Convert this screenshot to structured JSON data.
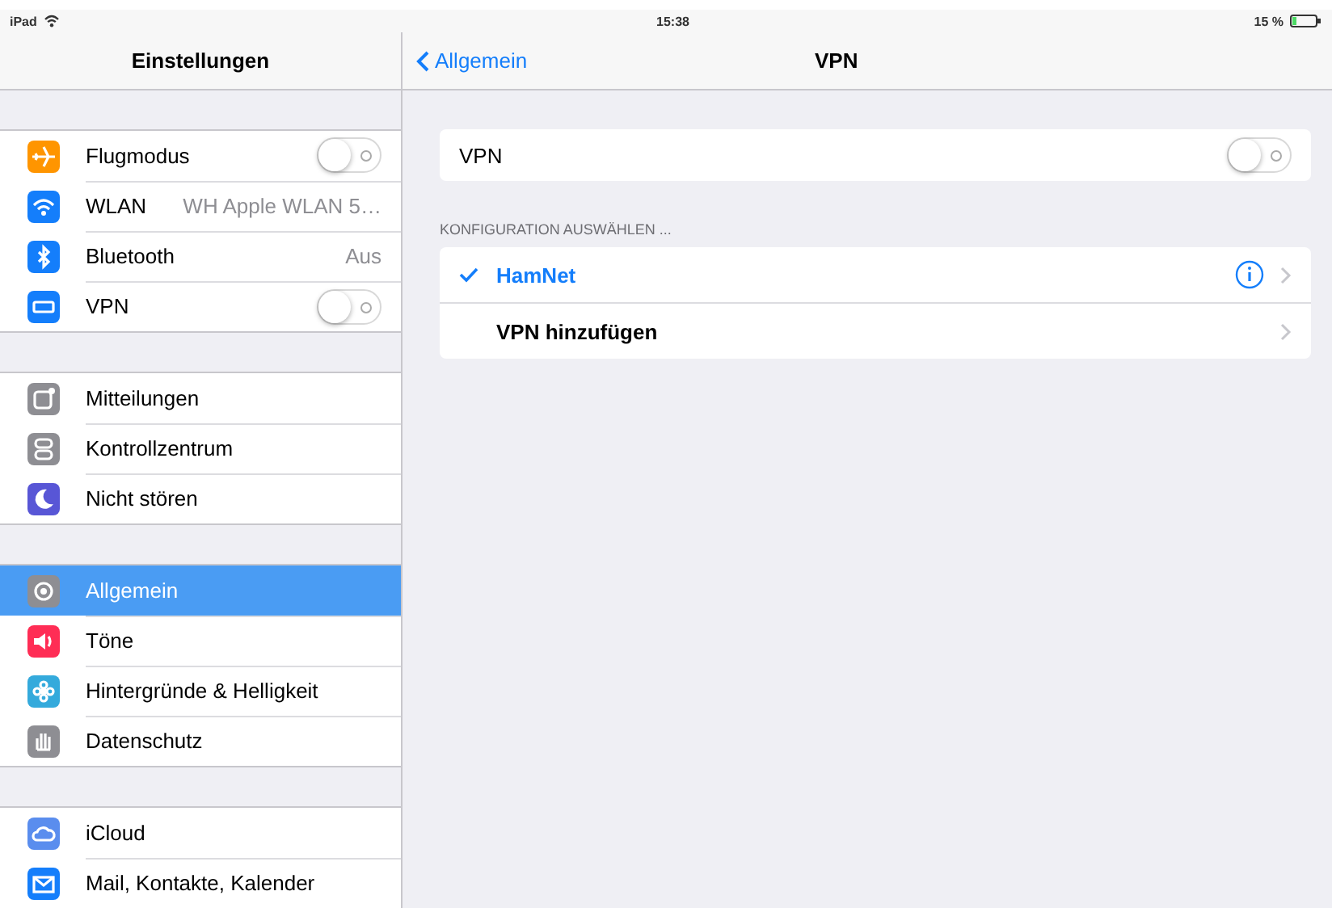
{
  "status_bar": {
    "device": "iPad",
    "time": "15:38",
    "battery": "15 %"
  },
  "sidebar": {
    "title": "Einstellungen",
    "groups": [
      {
        "items": [
          {
            "label": "Flugmodus",
            "kind": "toggle",
            "on": false,
            "selected": false,
            "color": "#ff9500"
          },
          {
            "label": "WLAN",
            "kind": "value",
            "value": "WH Apple WLAN 5…",
            "selected": false,
            "color": "#147efb"
          },
          {
            "label": "Bluetooth",
            "kind": "value",
            "value": "Aus",
            "selected": false,
            "color": "#147efb"
          },
          {
            "label": "VPN",
            "kind": "toggle",
            "on": false,
            "selected": false,
            "color": "#147efb"
          }
        ]
      },
      {
        "items": [
          {
            "label": "Mitteilungen",
            "kind": "plain",
            "selected": false,
            "color": "#8e8e93"
          },
          {
            "label": "Kontrollzentrum",
            "kind": "plain",
            "selected": false,
            "color": "#8e8e93"
          },
          {
            "label": "Nicht stören",
            "kind": "plain",
            "selected": false,
            "color": "#5856d6"
          }
        ]
      },
      {
        "items": [
          {
            "label": "Allgemein",
            "kind": "plain",
            "selected": true,
            "color": "#8e8e93"
          },
          {
            "label": "Töne",
            "kind": "plain",
            "selected": false,
            "color": "#ff2d55"
          },
          {
            "label": "Hintergründe & Helligkeit",
            "kind": "plain",
            "selected": false,
            "color": "#34aadc"
          },
          {
            "label": "Datenschutz",
            "kind": "plain",
            "selected": false,
            "color": "#8e8e93"
          }
        ]
      },
      {
        "items": [
          {
            "label": "iCloud",
            "kind": "plain",
            "selected": false,
            "color": "#5a8dee"
          },
          {
            "label": "Mail, Kontakte, Kalender",
            "kind": "plain",
            "selected": false,
            "color": "#147efb"
          }
        ]
      }
    ]
  },
  "detail": {
    "back": "Allgemein",
    "title": "VPN",
    "vpn_switch": {
      "label": "VPN",
      "on": false
    },
    "section_header": "KONFIGURATION AUSWÄHLEN ...",
    "configs": [
      {
        "label": "HamNet",
        "selected": true,
        "info": true
      },
      {
        "label": "VPN hinzufügen",
        "selected": false,
        "info": false
      }
    ]
  }
}
